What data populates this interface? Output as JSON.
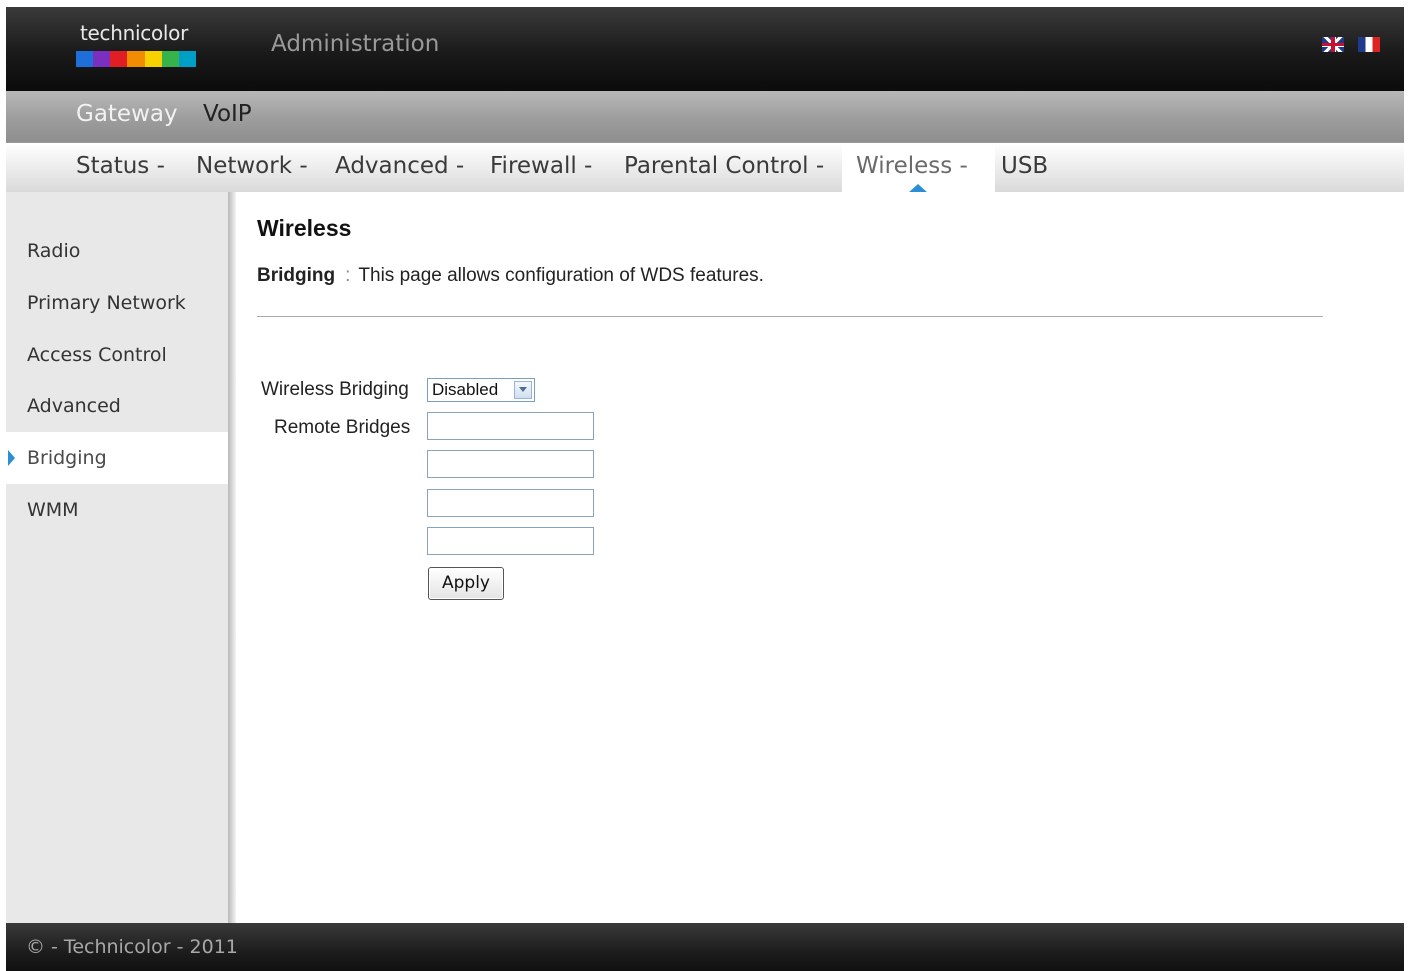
{
  "header": {
    "logo_text": "technicolor",
    "logo_colors": [
      "#1e6fd9",
      "#7b2fbf",
      "#e21e25",
      "#f28c00",
      "#f6d300",
      "#36b34a",
      "#00a0c6"
    ],
    "title": "Administration",
    "flags": [
      "uk-flag-icon",
      "fr-flag-icon"
    ]
  },
  "product_nav": {
    "items": [
      {
        "label": "Gateway",
        "active": true
      },
      {
        "label": "VoIP",
        "active": false
      }
    ]
  },
  "menu": {
    "items": [
      {
        "label": "Status -"
      },
      {
        "label": "Network -"
      },
      {
        "label": "Advanced -"
      },
      {
        "label": "Firewall -"
      },
      {
        "label": "Parental Control -"
      },
      {
        "label": "Wireless -",
        "active": true
      },
      {
        "label": "USB"
      }
    ],
    "accent_color": "#2a8fd6"
  },
  "sidebar": {
    "items": [
      {
        "label": "Radio"
      },
      {
        "label": "Primary Network"
      },
      {
        "label": "Access Control"
      },
      {
        "label": "Advanced"
      },
      {
        "label": "Bridging",
        "active": true
      },
      {
        "label": "WMM"
      }
    ]
  },
  "main": {
    "title": "Wireless",
    "desc_label": "Bridging",
    "desc_sep": ":",
    "desc_text": "This page allows configuration of WDS features.",
    "form": {
      "bridging_label": "Wireless Bridging",
      "bridging_value": "Disabled",
      "remote_label": "Remote Bridges",
      "remote_values": [
        "",
        "",
        "",
        ""
      ],
      "apply_label": "Apply"
    }
  },
  "footer": {
    "text": "© - Technicolor - 2011"
  }
}
